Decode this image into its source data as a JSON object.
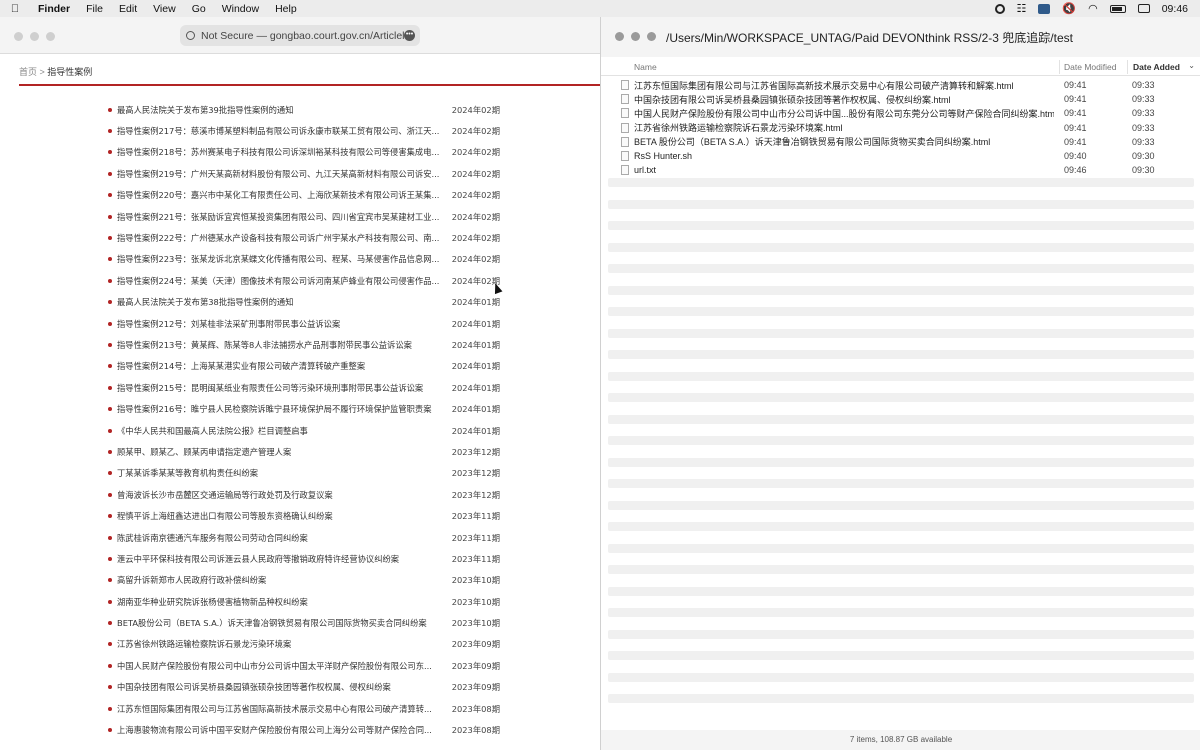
{
  "menubar": {
    "app": "Finder",
    "items": [
      "File",
      "Edit",
      "View",
      "Go",
      "Window",
      "Help"
    ],
    "clock": "09:46"
  },
  "safari": {
    "url": "Not Secure — gongbao.court.gov.cn/Articlel...",
    "breadcrumb_home": "首页",
    "breadcrumb_sep": " > ",
    "breadcrumb_current": "指导性案例",
    "articles": [
      {
        "title": "最高人民法院关于发布第39批指导性案例的通知",
        "date": "2024年02期"
      },
      {
        "title": "指导性案例217号：慈溪市博某塑料制品有限公司诉永康市联某工贸有限公司、浙江天...",
        "date": "2024年02期"
      },
      {
        "title": "指导性案例218号：苏州赛某电子科技有限公司诉深圳裕某科技有限公司等侵害集成电...",
        "date": "2024年02期"
      },
      {
        "title": "指导性案例219号：广州天某高新材料股份有限公司、九江天某高新材料有限公司诉安...",
        "date": "2024年02期"
      },
      {
        "title": "指导性案例220号：嘉兴市中某化工有限责任公司、上海欣某新技术有限公司诉王某集...",
        "date": "2024年02期"
      },
      {
        "title": "指导性案例221号：张某励诉宜宾恒某投资集团有限公司、四川省宜宾市吴某建材工业...",
        "date": "2024年02期"
      },
      {
        "title": "指导性案例222号：广州德某水产设备科技有限公司诉广州宇某水产科技有限公司、南...",
        "date": "2024年02期"
      },
      {
        "title": "指导性案例223号：张某龙诉北京某蝶文化传播有限公司、程某、马某侵害作品信息网...",
        "date": "2024年02期"
      },
      {
        "title": "指导性案例224号：某美（天津）图像技术有限公司诉河南某庐蜂业有限公司侵害作品...",
        "date": "2024年02期"
      },
      {
        "title": "最高人民法院关于发布第38批指导性案例的通知",
        "date": "2024年01期"
      },
      {
        "title": "指导性案例212号：刘某桂非法采矿刑事附带民事公益诉讼案",
        "date": "2024年01期"
      },
      {
        "title": "指导性案例213号：黄某辉、陈某等8人非法捕捞水产品刑事附带民事公益诉讼案",
        "date": "2024年01期"
      },
      {
        "title": "指导性案例214号：上海某某港实业有限公司破产清算转破产重整案",
        "date": "2024年01期"
      },
      {
        "title": "指导性案例215号：昆明闽某纸业有限责任公司等污染环境刑事附带民事公益诉讼案",
        "date": "2024年01期"
      },
      {
        "title": "指导性案例216号：睢宁县人民检察院诉睢宁县环境保护局不履行环境保护监管职责案",
        "date": "2024年01期"
      },
      {
        "title": "《中华人民共和国最高人民法院公报》栏目调整启事",
        "date": "2024年01期"
      },
      {
        "title": "顾某甲、顾某乙、顾某丙申请指定遗产管理人案",
        "date": "2023年12期"
      },
      {
        "title": "丁某某诉季某某等教育机构责任纠纷案",
        "date": "2023年12期"
      },
      {
        "title": "曾海波诉长沙市岳麓区交通运输局等行政处罚及行政复议案",
        "date": "2023年12期"
      },
      {
        "title": "程慎平诉上海纽鑫达进出口有限公司等股东资格确认纠纷案",
        "date": "2023年11期"
      },
      {
        "title": "陈武桂诉南京德通汽车服务有限公司劳动合同纠纷案",
        "date": "2023年11期"
      },
      {
        "title": "滙云中平环保科技有限公司诉滙云县人民政府等撤销政府特许经营协议纠纷案",
        "date": "2023年11期"
      },
      {
        "title": "高留升诉新郑市人民政府行政补偿纠纷案",
        "date": "2023年10期"
      },
      {
        "title": "湖南亚华种业研究院诉张杨侵害植物新品种权纠纷案",
        "date": "2023年10期"
      },
      {
        "title": "BETA股份公司（BETA S.A.）诉天津鲁冶钢铁贸易有限公司国际货物买卖合同纠纷案",
        "date": "2023年10期"
      },
      {
        "title": "江苏省徐州铁路运输检察院诉石景龙污染环境案",
        "date": "2023年09期"
      },
      {
        "title": "中国人民财产保险股份有限公司中山市分公司诉中国太平洋财产保险股份有限公司东...",
        "date": "2023年09期"
      },
      {
        "title": "中国杂技团有限公司诉吴桥县桑园镇张硕杂技团等著作权权属、侵权纠纷案",
        "date": "2023年09期"
      },
      {
        "title": "江苏东恒国际集团有限公司与江苏省国际高新技术展示交易中心有限公司破产清算转...",
        "date": "2023年08期"
      },
      {
        "title": "上海惠骏物流有限公司诉中国平安财产保险股份有限公司上海分公司等财产保险合同...",
        "date": "2023年08期"
      }
    ]
  },
  "finder": {
    "path": "/Users/Min/WORKSPACE_UNTAG/Paid DEVONthink RSS/2-3 兜底追踪/test",
    "columns": {
      "name": "Name",
      "modified": "Date Modified",
      "added": "Date Added"
    },
    "files": [
      {
        "name": "江苏东恒国际集团有限公司与江苏省国际高新技术展示交易中心有限公司破产清算转和解案.html",
        "modified": "09:41",
        "added": "09:33"
      },
      {
        "name": "中国杂技团有限公司诉吴桥县桑园镇张硕杂技团等著作权权属、侵权纠纷案.html",
        "modified": "09:41",
        "added": "09:33"
      },
      {
        "name": "中国人民财产保险股份有限公司中山市分公司诉中国...股份有限公司东莞分公司等财产保险合同纠纷案.html",
        "modified": "09:41",
        "added": "09:33"
      },
      {
        "name": "江苏省徐州铁路运输检察院诉石景龙污染环境案.html",
        "modified": "09:41",
        "added": "09:33"
      },
      {
        "name": "BETA 股份公司（BETA S.A.）诉天津鲁冶钢铁贸易有限公司国际货物买卖合同纠纷案.html",
        "modified": "09:41",
        "added": "09:33"
      },
      {
        "name": "RsS Hunter.sh",
        "modified": "09:40",
        "added": "09:30"
      },
      {
        "name": "url.txt",
        "modified": "09:46",
        "added": "09:30"
      }
    ],
    "status": "7 items, 108.87 GB available"
  }
}
